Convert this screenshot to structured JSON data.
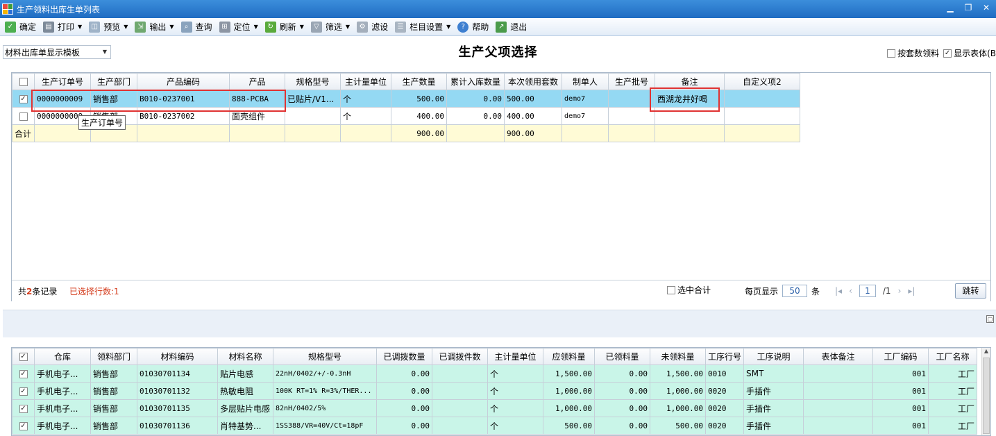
{
  "window": {
    "title": "生产领料出库生单列表"
  },
  "toolbar": {
    "confirm": "确定",
    "print": "打印",
    "preview": "预览",
    "export": "输出",
    "query": "查询",
    "locate": "定位",
    "refresh": "刷新",
    "filter": "筛选",
    "setfilter": "滤设",
    "columns": "栏目设置",
    "help": "帮助",
    "exit": "退出"
  },
  "template": {
    "selected": "材料出库单显示模板"
  },
  "page_title": "生产父项选择",
  "options": {
    "by_set": "按套数领料",
    "show_body": "显示表体(B"
  },
  "upper_table": {
    "headers": [
      "生产订单号",
      "生产部门",
      "产品编码",
      "产品",
      "规格型号",
      "主计量单位",
      "生产数量",
      "累计入库数量",
      "本次领用套数",
      "制单人",
      "生产批号",
      "备注",
      "自定义项2"
    ],
    "rows": [
      {
        "checked": "✓",
        "order": "0000000009",
        "dept": "销售部",
        "code": "B010-0237001",
        "product": "888-PCBA",
        "spec": "已贴片/V1...",
        "unit": "个",
        "qty": "500.00",
        "in_qty": "0.00",
        "sets": "500.00",
        "maker": "demo7",
        "batch": "",
        "remark": "西湖龙井好喝",
        "def2": ""
      },
      {
        "checked": "",
        "order": "0000000009",
        "dept": "销售部",
        "code": "B010-0237002",
        "product": "面壳组件",
        "spec": "",
        "unit": "个",
        "qty": "400.00",
        "in_qty": "0.00",
        "sets": "400.00",
        "maker": "demo7",
        "batch": "",
        "remark": "",
        "def2": ""
      }
    ],
    "total": {
      "label": "合计",
      "qty": "900.00",
      "sets": "900.00"
    },
    "tooltip": "生产订单号"
  },
  "footer": {
    "count_prefix": "共",
    "count": "2",
    "count_suffix": "条记录",
    "selected": "已选择行数:1",
    "sum_selected": "选中合计",
    "per_page_label": "每页显示",
    "per_page": "50",
    "per_page_unit": "条",
    "page": "1",
    "total_pages": "/1",
    "jump": "跳转"
  },
  "lower_table": {
    "headers": [
      "仓库",
      "领料部门",
      "材料编码",
      "材料名称",
      "规格型号",
      "已调拨数量",
      "已调拨件数",
      "主计量单位",
      "应领料量",
      "已领料量",
      "未领料量",
      "工序行号",
      "工序说明",
      "表体备注",
      "工厂编码",
      "工厂名称"
    ],
    "rows": [
      {
        "wh": "手机电子...",
        "dept": "销售部",
        "code": "01030701134",
        "name": "贴片电感",
        "spec": "22nH/0402/+/-0.3nH",
        "tq": "0.00",
        "tp": "",
        "unit": "个",
        "req": "1,500.00",
        "got": "0.00",
        "left": "1,500.00",
        "op": "0010",
        "opdesc": "SMT",
        "remark": "",
        "fcode": "001",
        "fname": "工厂"
      },
      {
        "wh": "手机电子...",
        "dept": "销售部",
        "code": "01030701132",
        "name": "热敏电阻",
        "spec": "100K RT=1% R=3%/THER...",
        "tq": "0.00",
        "tp": "",
        "unit": "个",
        "req": "1,000.00",
        "got": "0.00",
        "left": "1,000.00",
        "op": "0020",
        "opdesc": "手插件",
        "remark": "",
        "fcode": "001",
        "fname": "工厂"
      },
      {
        "wh": "手机电子...",
        "dept": "销售部",
        "code": "01030701135",
        "name": "多层贴片电感",
        "spec": "82nH/0402/5%",
        "tq": "0.00",
        "tp": "",
        "unit": "个",
        "req": "1,000.00",
        "got": "0.00",
        "left": "1,000.00",
        "op": "0020",
        "opdesc": "手插件",
        "remark": "",
        "fcode": "001",
        "fname": "工厂"
      },
      {
        "wh": "手机电子...",
        "dept": "销售部",
        "code": "01030701136",
        "name": "肖特基势...",
        "spec": "1SS388/VR=40V/Ct=18pF",
        "tq": "0.00",
        "tp": "",
        "unit": "个",
        "req": "500.00",
        "got": "0.00",
        "left": "500.00",
        "op": "0020",
        "opdesc": "手插件",
        "remark": "",
        "fcode": "001",
        "fname": "工厂"
      }
    ]
  }
}
